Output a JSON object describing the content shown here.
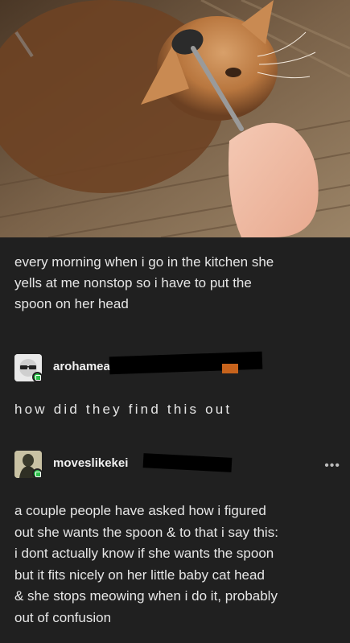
{
  "post": {
    "image_alt": "orange cat being fed with a spoon",
    "text_lines": [
      "every morning when i go in the kitchen she",
      "yells at me nonstop so i have to put the",
      "spoon on her head"
    ]
  },
  "reblogs": [
    {
      "username": "arohamea",
      "avatar_icon": "sunglasses-avatar-icon",
      "text": "how did they find this out"
    },
    {
      "username": "moveslikekei",
      "avatar_icon": "figure-avatar-icon",
      "more_label": "•••",
      "text_lines": [
        "a couple people have asked how i figured",
        "out she wants the spoon & to that i say this:",
        "i dont actually know if she wants the spoon",
        "but it fits nicely on her little baby cat head",
        "& she stops meowing when i do it, probably",
        "out of confusion"
      ]
    }
  ],
  "colors": {
    "background": "#202020",
    "text": "#e6e6e6",
    "badge": "#2dbf4a"
  }
}
